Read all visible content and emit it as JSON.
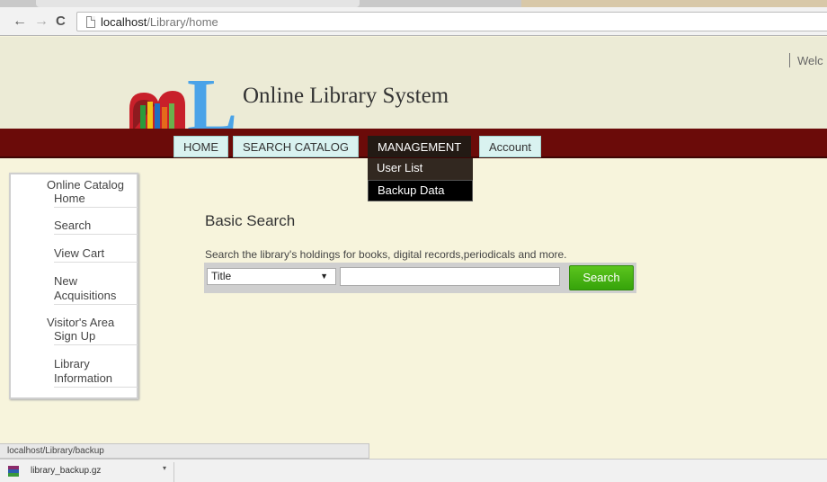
{
  "browser": {
    "back_glyph": "←",
    "forward_glyph": "→",
    "reload_glyph": "C",
    "url_host": "localhost",
    "url_path": "/Library/home",
    "status_url": "localhost/Library/backup",
    "download_file": "library_backup.gz",
    "download_caret": "▾"
  },
  "header": {
    "welcome": "Welc",
    "site_title": "Online Library System",
    "logo_letter": "L"
  },
  "nav": {
    "home": "HOME",
    "search_catalog": "SEARCH CATALOG",
    "management": "MANAGEMENT",
    "account": "Account",
    "dropdown": {
      "user_list": "User List",
      "backup_data": "Backup Data"
    }
  },
  "sidebar": {
    "online_catalog": "Online Catalog",
    "home": "Home",
    "search": "Search",
    "view_cart": "View Cart",
    "new_acquisitions_1": "New",
    "new_acquisitions_2": "Acquisitions",
    "visitors_area": "Visitor's Area",
    "sign_up": "Sign Up",
    "library_information_1": "Library",
    "library_information_2": "Information"
  },
  "main": {
    "heading": "Basic Search",
    "description": "Search the library's holdings for books, digital records,periodicals and more.",
    "select_value": "Title",
    "select_arrow": "▼",
    "search_value": "",
    "search_button": "Search"
  },
  "colors": {
    "navbar": "#6b0b09",
    "page_background": "#f7f4dc",
    "header_background": "#ecebd6",
    "search_button": "#42ad12",
    "logo_blue": "#4aa3e8"
  }
}
